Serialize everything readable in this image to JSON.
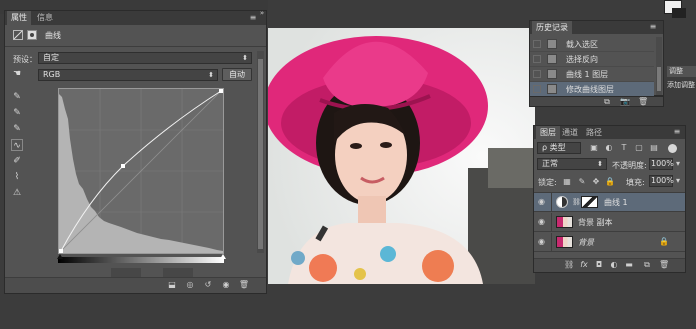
{
  "props_panel": {
    "tabs": [
      "属性",
      "信息"
    ],
    "header_title": "曲线",
    "preset_label": "预设：",
    "preset_value": "自定",
    "channel_value": "RGB",
    "auto_button": "自动"
  },
  "history_panel": {
    "title": "历史记录",
    "items": [
      "载入选区",
      "选择反向",
      "曲线 1 图层",
      "修改曲线图层"
    ]
  },
  "layers_panel": {
    "tabs": [
      "图层",
      "通道",
      "路径"
    ],
    "kind_label": "ρ 类型",
    "blend_mode": "正常",
    "opacity_label": "不透明度:",
    "opacity_value": "100%",
    "lock_label": "锁定:",
    "fill_label": "填充:",
    "fill_value": "100%",
    "layers": [
      {
        "name": "曲线 1",
        "type": "adjustment"
      },
      {
        "name": "背景 副本",
        "type": "image"
      },
      {
        "name": "背景",
        "type": "background"
      }
    ]
  },
  "right_edge": {
    "tab_label": "调整",
    "add_label": "添加调整"
  },
  "colors": {
    "panel_bg": "#535353",
    "workspace_bg": "#3c3c3c",
    "selected_row": "#5d6a79",
    "hat_magenta": "#e0287a"
  }
}
